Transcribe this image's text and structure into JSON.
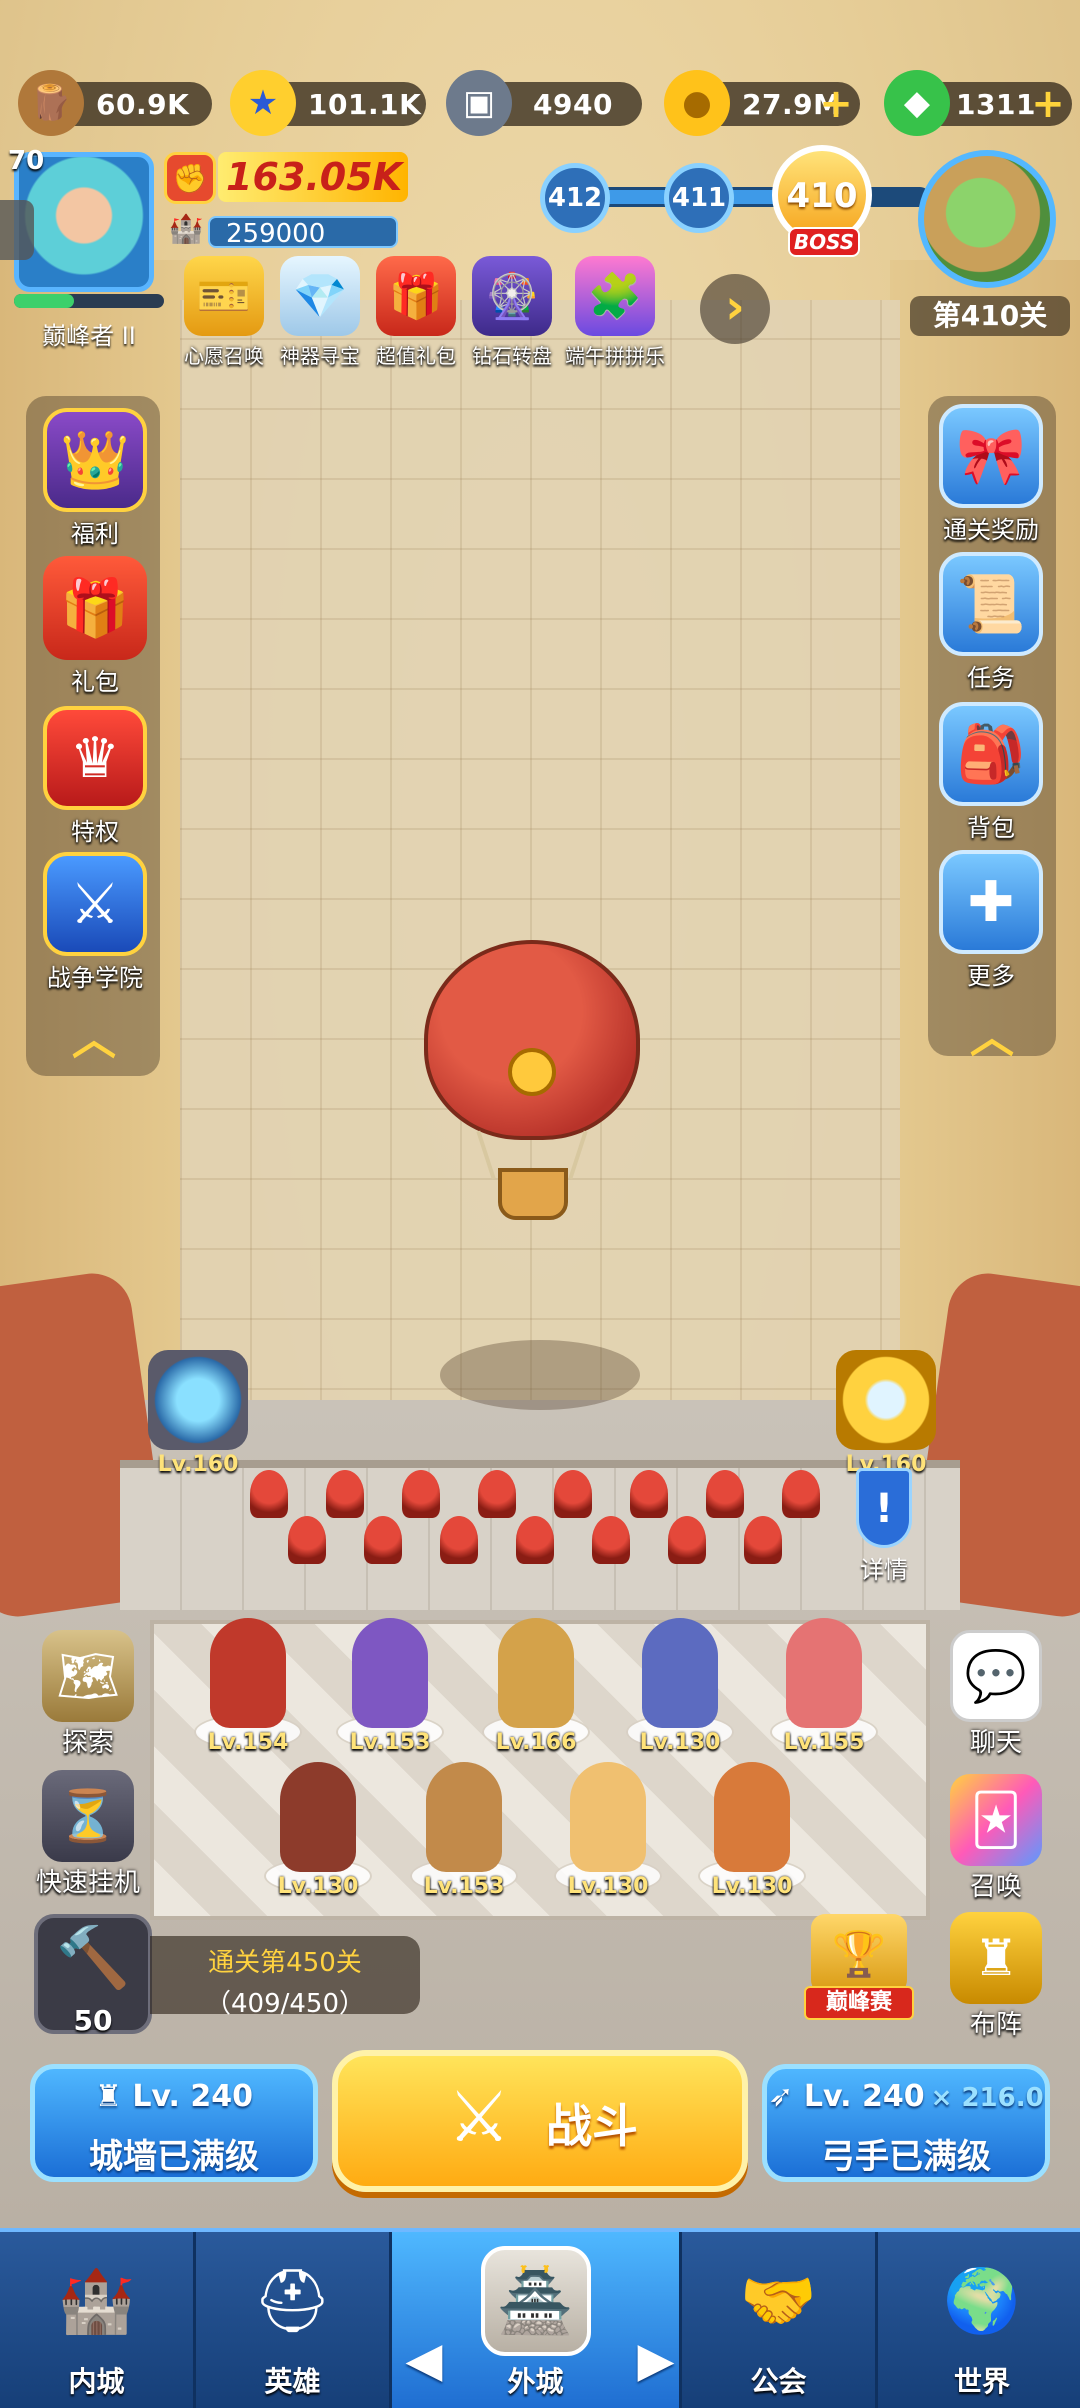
{
  "resources": [
    {
      "name": "wood",
      "icon": "wood-log-icon",
      "value": "60.9K",
      "plus": false
    },
    {
      "name": "medal",
      "icon": "star-medal-icon",
      "value": "101.1K",
      "plus": false
    },
    {
      "name": "iron",
      "icon": "iron-ingot-icon",
      "value": "4940",
      "plus": false
    },
    {
      "name": "gold",
      "icon": "gold-coin-icon",
      "value": "27.9M",
      "plus": true
    },
    {
      "name": "gem",
      "icon": "green-gem-icon",
      "value": "1311",
      "plus": true
    }
  ],
  "player": {
    "level": "70",
    "power": "163.05K",
    "castle_power": "259000",
    "rank": "巅峰者 II",
    "rank_progress": 0.4
  },
  "events": [
    {
      "label": "心愿召唤",
      "icon": "wish-ticket-icon"
    },
    {
      "label": "神器寻宝",
      "icon": "artifact-crystal-icon"
    },
    {
      "label": "超值礼包",
      "icon": "treasure-chest-icon"
    },
    {
      "label": "钻石转盘",
      "icon": "diamond-wheel-icon"
    },
    {
      "label": "端午拼拼乐",
      "icon": "puzzle-icon"
    }
  ],
  "events_more": "›",
  "stages": {
    "prev2": "412",
    "prev1": "411",
    "current": "410",
    "boss_label": "BOSS",
    "progress": 0.7
  },
  "world_map": {
    "label": "第410关",
    "icon": "world-map-globe-icon"
  },
  "left_menu": [
    {
      "label": "福利",
      "icon": "crown-shield-icon"
    },
    {
      "label": "礼包",
      "icon": "gift-box-icon"
    },
    {
      "label": "特权",
      "icon": "crown-badge-icon"
    },
    {
      "label": "战争学院",
      "icon": "crossed-swords-shield-icon"
    }
  ],
  "right_menu": [
    {
      "label": "通关奖励",
      "icon": "gift-reward-icon"
    },
    {
      "label": "任务",
      "icon": "scroll-task-icon"
    },
    {
      "label": "背包",
      "icon": "backpack-icon"
    },
    {
      "label": "更多",
      "icon": "plus-cross-icon"
    }
  ],
  "towers": [
    {
      "label": "Lv.160",
      "icon": "magic-orb-tower-icon"
    },
    {
      "label": "Lv.160",
      "icon": "golden-crystal-tower-icon"
    }
  ],
  "detail_label": "详情",
  "heroes": [
    {
      "level": "Lv.154",
      "color": "#c0392b"
    },
    {
      "level": "Lv.153",
      "color": "#7e57c2"
    },
    {
      "level": "Lv.166",
      "color": "#d4a24a"
    },
    {
      "level": "Lv.130",
      "color": "#5c6bc0"
    },
    {
      "level": "Lv.155",
      "color": "#e57373"
    },
    {
      "level": "Lv.130",
      "color": "#8d3b2b"
    },
    {
      "level": "Lv.153",
      "color": "#c28a4a"
    },
    {
      "level": "Lv.130",
      "color": "#f0c070"
    },
    {
      "level": "Lv.130",
      "color": "#d87a3a"
    }
  ],
  "left_actions": [
    {
      "label": "探索",
      "icon": "treasure-map-icon"
    },
    {
      "label": "快速挂机",
      "icon": "hourglass-icon"
    }
  ],
  "right_actions": [
    {
      "label": "聊天",
      "icon": "chat-bubble-icon"
    },
    {
      "label": "召唤",
      "icon": "summon-cards-icon"
    },
    {
      "label": "布阵",
      "icon": "chess-formation-icon"
    }
  ],
  "forge": {
    "count": "50",
    "icon": "hammer-icon"
  },
  "stage_clear": {
    "title": "通关第450关",
    "progress": "（409/450）"
  },
  "peak_arena": {
    "label": "巅峰赛",
    "icon": "trophy-icon"
  },
  "wall": {
    "level": "Lv. 240",
    "status": "城墙已满级",
    "icon": "castle-tower-icon"
  },
  "archer": {
    "level": "Lv. 240",
    "bonus": "× 216.0",
    "status": "弓手已满级",
    "icon": "bow-icon"
  },
  "fight": {
    "label": "战斗",
    "icon": "crossed-swords-icon"
  },
  "nav": [
    {
      "label": "内城",
      "icon": "inner-castle-icon"
    },
    {
      "label": "英雄",
      "icon": "hero-helmet-icon"
    },
    {
      "label": "外城",
      "icon": "outer-castle-icon"
    },
    {
      "label": "公会",
      "icon": "guild-handshake-icon"
    },
    {
      "label": "世界",
      "icon": "world-globe-icon"
    }
  ],
  "nav_prev": "◀",
  "nav_next": "▶",
  "colors": {
    "accent_blue": "#1b6fd6",
    "accent_gold": "#ffab12",
    "power_red": "#c8211a"
  }
}
